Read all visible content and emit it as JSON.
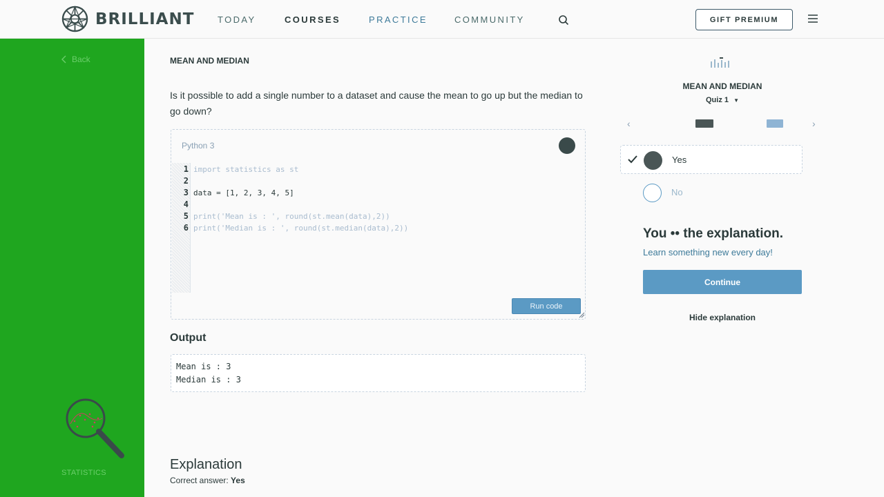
{
  "nav": {
    "brand": "BRILLIANT",
    "items": [
      {
        "label": "TODAY"
      },
      {
        "label": "COURSES"
      },
      {
        "label": "PRACTICE"
      },
      {
        "label": "COMMUNITY"
      }
    ],
    "gift_label": "GIFT PREMIUM"
  },
  "sidebar": {
    "back_label": "Back",
    "course_label": "STATISTICS",
    "color": "#1fa61f"
  },
  "main": {
    "section_title": "MEAN AND MEDIAN",
    "question": "Is it possible to add a single number to a dataset and cause the mean to go up but the median to go down?",
    "editor": {
      "language": "Python 3",
      "lines": [
        {
          "n": "1",
          "text": "import statistics as st"
        },
        {
          "n": "2",
          "text": ""
        },
        {
          "n": "3",
          "text": "data = [1, 2, 3, 4, 5]"
        },
        {
          "n": "4",
          "text": ""
        },
        {
          "n": "5",
          "text": "print('Mean is : ', round(st.mean(data),2))"
        },
        {
          "n": "6",
          "text": "print('Median is : ', round(st.median(data),2))"
        }
      ],
      "run_label": "Run code"
    },
    "output_title": "Output",
    "output_lines": [
      "Mean is : 3",
      "Median is : 3"
    ],
    "explanation_title": "Explanation",
    "correct_answer_label": "Correct answer:",
    "correct_answer_value": "Yes"
  },
  "quiz": {
    "title": "MEAN AND MEDIAN",
    "selector": "Quiz 1",
    "choices": [
      {
        "label": "Yes",
        "selected": true
      },
      {
        "label": "No",
        "selected": false
      }
    ],
    "explain_head": "You •• the explanation.",
    "explain_sub": "Learn something new every day!",
    "continue_label": "Continue",
    "hide_label": "Hide explanation",
    "accent": "#5b9ac4"
  }
}
